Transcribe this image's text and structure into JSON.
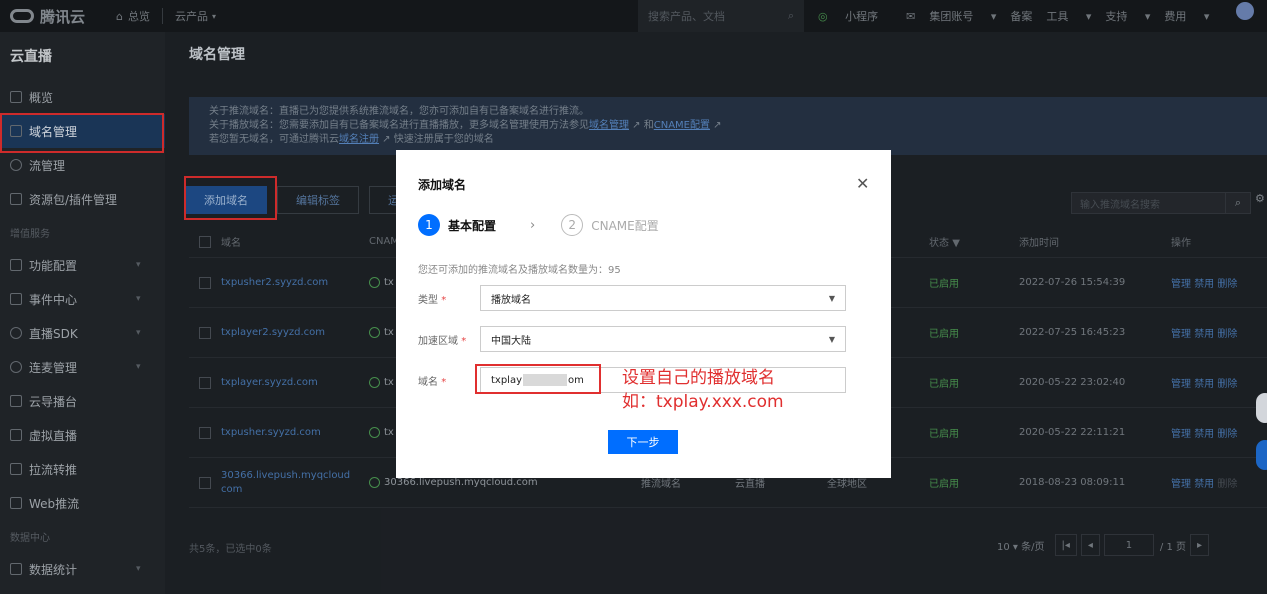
{
  "topbar": {
    "brand": "腾讯云",
    "overview": "总览",
    "products": "云产品",
    "search_placeholder": "搜索产品、文档",
    "mini_program": "小程序",
    "account": "集团账号",
    "filing": "备案",
    "tools": "工具",
    "support": "支持",
    "billing": "费用"
  },
  "sidebar": {
    "title": "云直播",
    "items": [
      {
        "label": "概览"
      },
      {
        "label": "域名管理"
      },
      {
        "label": "流管理"
      },
      {
        "label": "资源包/插件管理"
      }
    ],
    "group1": "增值服务",
    "items2": [
      {
        "label": "功能配置"
      },
      {
        "label": "事件中心"
      },
      {
        "label": "直播SDK"
      },
      {
        "label": "连麦管理"
      },
      {
        "label": "云导播台"
      },
      {
        "label": "虚拟直播"
      },
      {
        "label": "拉流转推"
      },
      {
        "label": "Web推流"
      }
    ],
    "group2": "数据中心",
    "items3": [
      {
        "label": "数据统计"
      }
    ]
  },
  "main": {
    "title": "域名管理",
    "notice": {
      "line1": "关于推流域名：直播已为您提供系统推流域名，您亦可添加自有已备案域名进行推流。",
      "line2_a": "关于播放域名：您需要添加自有已备案域名进行直播播放，更多域名管理使用方法参见",
      "line2_link1": "域名管理",
      "line2_b": "和",
      "line2_link2": "CNAME配置",
      "line3_a": "若您暂无域名，可通过腾讯云",
      "line3_link": "域名注册",
      "line3_b": "快速注册属于您的域名"
    },
    "add_domain_button": "添加域名",
    "edit_tag_button": "编辑标签",
    "third_button": "运",
    "search_placeholder": "输入推流域名搜索",
    "table": {
      "headers": {
        "domain": "域名",
        "cname": "CNAME",
        "status": "状态",
        "added": "添加时间",
        "ops": "操作"
      },
      "rows": [
        {
          "domain": "txpusher2.syyzd.com",
          "cname": "tx",
          "status": "已启用",
          "added": "2022-07-26 15:54:39",
          "op1": "管理",
          "op2": "禁用",
          "op3": "删除"
        },
        {
          "domain": "txplayer2.syyzd.com",
          "cname": "tx",
          "status": "已启用",
          "added": "2022-07-25 16:45:23",
          "op1": "管理",
          "op2": "禁用",
          "op3": "删除"
        },
        {
          "domain": "txplayer.syyzd.com",
          "cname": "tx",
          "status": "已启用",
          "added": "2020-05-22 23:02:40",
          "op1": "管理",
          "op2": "禁用",
          "op3": "删除"
        },
        {
          "domain": "txpusher.syyzd.com",
          "cname": "tx",
          "status": "已启用",
          "added": "2020-05-22 22:11:21",
          "op1": "管理",
          "op2": "禁用",
          "op3": "删除"
        },
        {
          "domain_l1": "30366.livepush.myqcloud",
          "domain_l2": "com",
          "cname": "30366.livepush.myqcloud.com",
          "type": "推流域名",
          "src": "云直播",
          "region": "全球地区",
          "status": "已启用",
          "added": "2018-08-23 08:09:11",
          "op1": "管理",
          "op2": "禁用",
          "op3": "删除"
        }
      ]
    },
    "footer_count": "共5条，已选中0条",
    "pager": {
      "page_size": "10",
      "page_size_unit": "条/页",
      "current": "1",
      "total": "/ 1 页"
    }
  },
  "dialog": {
    "title": "添加域名",
    "step1_num": "1",
    "step1_label": "基本配置",
    "step2_num": "2",
    "step2_label": "CNAME配置",
    "hint": "您还可添加的推流域名及播放域名数量为：95",
    "type_label": "类型",
    "type_value": "播放域名",
    "region_label": "加速区域",
    "region_value": "中国大陆",
    "domain_label": "域名",
    "domain_prefix": "txplay",
    "domain_suffix": "om",
    "next_button": "下一步"
  },
  "annotation": {
    "line1": "设置自己的播放域名",
    "line2": "如：txplay.xxx.com"
  },
  "colors": {
    "annotation_red": "#e02f2f",
    "primary_blue": "#006eff"
  }
}
